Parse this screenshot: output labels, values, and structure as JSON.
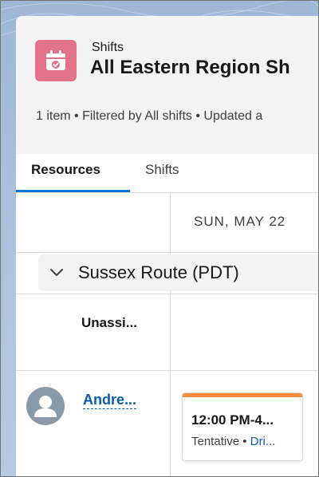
{
  "header": {
    "object_label": "Shifts",
    "title": "All Eastern Region Sh",
    "meta": "1 item • Filtered by All shifts • Updated a",
    "icon": "calendar-check-icon"
  },
  "tabs": [
    {
      "label": "Resources",
      "active": true
    },
    {
      "label": "Shifts",
      "active": false
    }
  ],
  "schedule": {
    "date_header": "SUN, MAY 22",
    "group_label": "Sussex Route (PDT)",
    "unassigned_label": "Unassi...",
    "resource": {
      "name": "Andre...",
      "avatar_icon": "user-avatar-icon"
    },
    "shift": {
      "time": "12:00 PM-4...",
      "status": "Tentative",
      "separator": " • ",
      "role": "Dri..."
    }
  },
  "colors": {
    "accent": "#0176d3",
    "icon_bg": "#e3728b",
    "shift_bar": "#f38b3c",
    "link": "#0b5cab"
  }
}
